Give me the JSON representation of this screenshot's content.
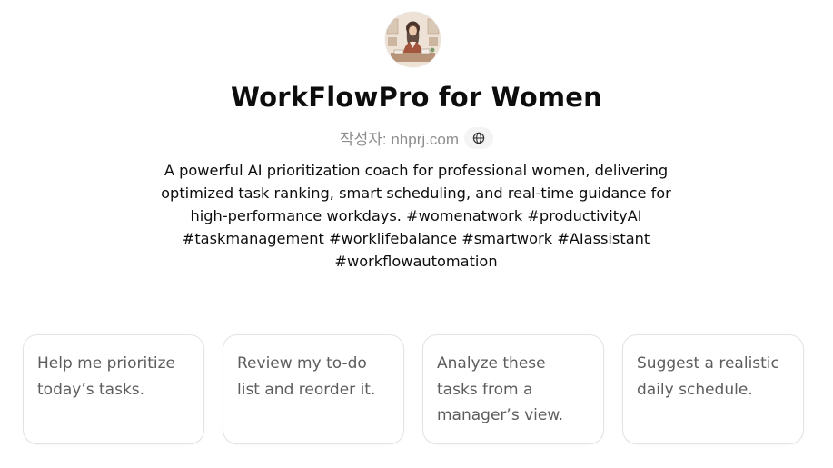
{
  "gpt": {
    "title": "WorkFlowPro for Women",
    "byline_author": "작성자: nhprj.com",
    "website_icon": "globe-icon",
    "avatar_icon": "professional-woman-avatar",
    "description": "A powerful AI prioritization coach for professional women, delivering optimized task ranking, smart scheduling, and real-time guidance for high-performance workdays. #womenatwork #productivityAI #taskmanagement #worklifebalance #smartwork #AIassistant #workflowautomation"
  },
  "conversation_starters": [
    {
      "label": "Help me prioritize today’s tasks."
    },
    {
      "label": "Review my to-do list and reorder it."
    },
    {
      "label": "Analyze these tasks from a manager’s view."
    },
    {
      "label": "Suggest a realistic daily schedule."
    }
  ],
  "colors": {
    "text_primary": "#0d0d0d",
    "text_muted": "#8e8e8e",
    "starter_text": "#5d5d5d",
    "border": "#e3e3e3"
  }
}
